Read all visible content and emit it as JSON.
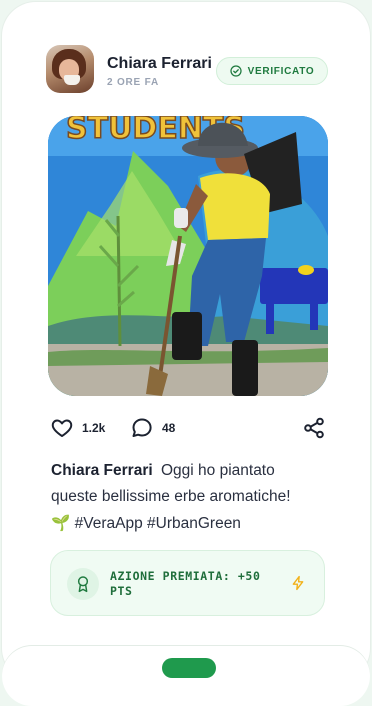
{
  "post": {
    "author": "Chiara Ferrari",
    "time_ago": "2 ORE FA",
    "badge": "VERIFICATO",
    "photo_sign_text": "STUDENTS",
    "likes": "1.2k",
    "comments": "48",
    "caption_name": "Chiara Ferrari",
    "caption_line1": "Oggi ho piantato",
    "caption_line2": "queste bellissime erbe aromatiche!",
    "caption_emoji": "🌱",
    "caption_tags": "#VeraApp #UrbanGreen",
    "reward_text": "AZIONE PREMIATA: +50 PTS"
  },
  "icons": [
    "check-circle-icon",
    "heart-icon",
    "comment-icon",
    "share-icon",
    "award-icon",
    "bolt-icon"
  ],
  "colors": {
    "accent": "#1f9a4d",
    "badge_text": "#1f7a3f",
    "bolt": "#f2b21b"
  }
}
